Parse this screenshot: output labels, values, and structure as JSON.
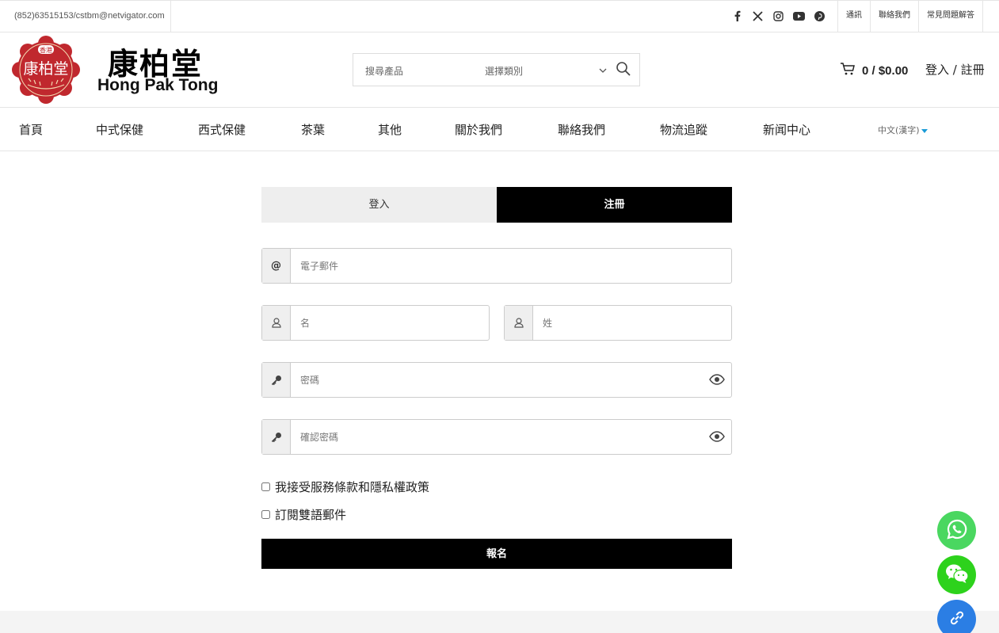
{
  "topbar": {
    "contact": "(852)63515153/cstbm@netvigator.com",
    "socials": [
      "facebook-icon",
      "x-icon",
      "instagram-icon",
      "youtube-icon",
      "pinterest-icon"
    ],
    "links": [
      "通訊",
      "聯絡我們",
      "常見問題解答"
    ]
  },
  "header": {
    "logo_top_text": "香港",
    "logo_main_text": "康柏堂",
    "brand_cn": "康柏堂",
    "brand_en": "Hong Pak Tong",
    "search_placeholder": "搜尋產品",
    "category_label": "選擇類別",
    "cart_value": "0 / $0.00",
    "login_link": "登入 / 註冊"
  },
  "nav": {
    "items": [
      "首頁",
      "中式保健",
      "西式保健",
      "茶葉",
      "其他",
      "關於我們",
      "聯絡我們",
      "物流追蹤",
      "新闻中心"
    ],
    "language": "中文(漢字)"
  },
  "form": {
    "tab_login": "登入",
    "tab_register": "注冊",
    "email_placeholder": "電子郵件",
    "first_name_placeholder": "名",
    "last_name_placeholder": "姓",
    "password_placeholder": "密碼",
    "confirm_password_placeholder": "確認密碼",
    "email_icon_text": "@",
    "terms_label": "我接受服務條款和隱私權政策",
    "newsletter_label": "訂閱雙語郵件",
    "submit_label": "報名"
  },
  "colors": {
    "brand_red": "#c0282e",
    "black": "#000000",
    "whatsapp": "#4ad760",
    "wechat": "#2dd21c",
    "link": "#2b7ee4"
  }
}
